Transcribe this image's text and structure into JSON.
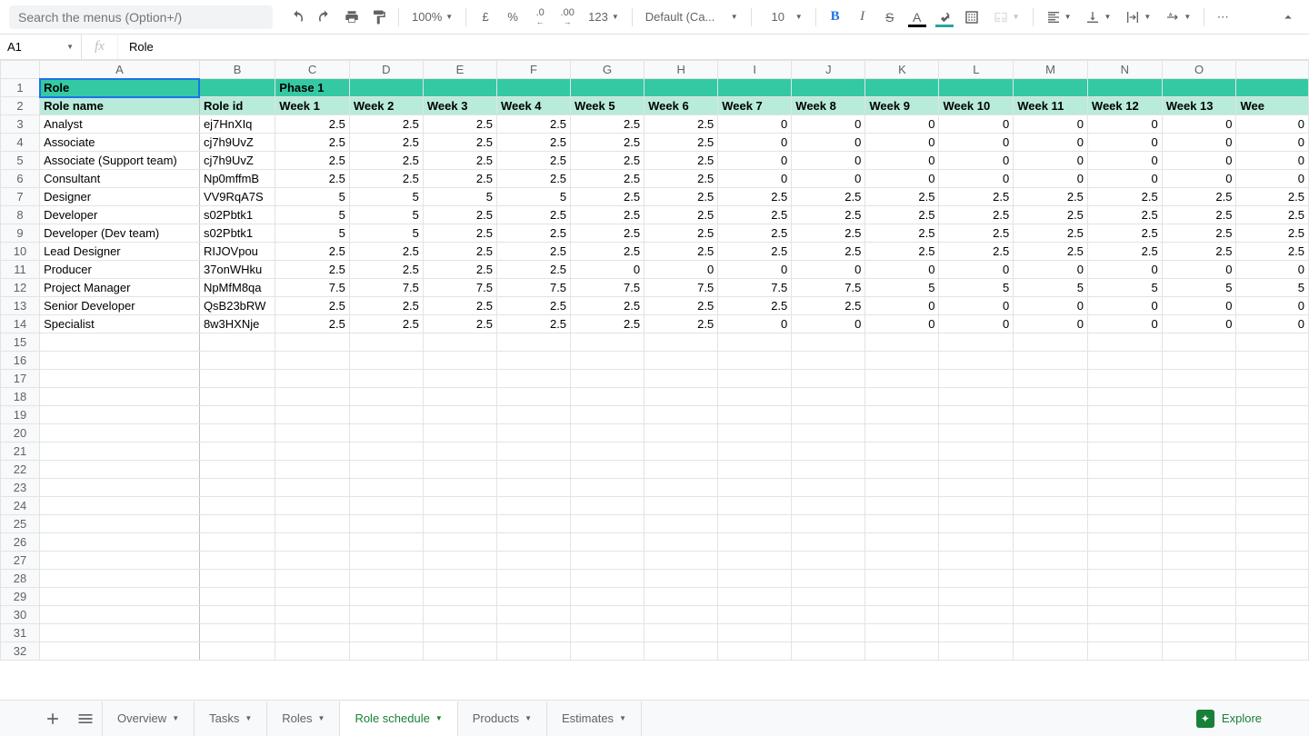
{
  "toolbar": {
    "search_placeholder": "Search the menus (Option+/)",
    "zoom": "100%",
    "currency": "£",
    "percent": "%",
    "dec_minus": ".0",
    "dec_plus": ".00",
    "more_fmt": "123",
    "font_name": "Default (Ca...",
    "font_size": "10",
    "bold": "B",
    "italic": "I",
    "strike": "S",
    "text_color": "A",
    "more": "⋯"
  },
  "name_box": "A1",
  "formula_value": "Role",
  "colors": {
    "header1": "#34c9a3",
    "header2": "#b8ebd9",
    "selection": "#1a73e8",
    "explore": "#188038"
  },
  "columns": [
    "A",
    "B",
    "C",
    "D",
    "E",
    "F",
    "G",
    "H",
    "I",
    "J",
    "K",
    "L",
    "M",
    "N",
    "O",
    ""
  ],
  "row1": {
    "A": "Role",
    "C": "Phase 1"
  },
  "row2": [
    "Role name",
    "Role id",
    "Week 1",
    "Week 2",
    "Week 3",
    "Week 4",
    "Week 5",
    "Week 6",
    "Week 7",
    "Week 8",
    "Week 9",
    "Week 10",
    "Week 11",
    "Week 12",
    "Week 13",
    "Wee"
  ],
  "rows": [
    {
      "name": "Analyst",
      "id": "ej7HnXIq",
      "v": [
        2.5,
        2.5,
        2.5,
        2.5,
        2.5,
        2.5,
        0,
        0,
        0,
        0,
        0,
        0,
        0,
        0
      ]
    },
    {
      "name": "Associate",
      "id": "cj7h9UvZ",
      "v": [
        2.5,
        2.5,
        2.5,
        2.5,
        2.5,
        2.5,
        0,
        0,
        0,
        0,
        0,
        0,
        0,
        0
      ]
    },
    {
      "name": "Associate (Support team)",
      "id": "cj7h9UvZ",
      "v": [
        2.5,
        2.5,
        2.5,
        2.5,
        2.5,
        2.5,
        0,
        0,
        0,
        0,
        0,
        0,
        0,
        0
      ]
    },
    {
      "name": "Consultant",
      "id": "Np0mffmB",
      "v": [
        2.5,
        2.5,
        2.5,
        2.5,
        2.5,
        2.5,
        0,
        0,
        0,
        0,
        0,
        0,
        0,
        0
      ]
    },
    {
      "name": "Designer",
      "id": "VV9RqA7S",
      "v": [
        5,
        5,
        5,
        5,
        2.5,
        2.5,
        2.5,
        2.5,
        2.5,
        2.5,
        2.5,
        2.5,
        2.5,
        2.5
      ]
    },
    {
      "name": "Developer",
      "id": "s02Pbtk1",
      "v": [
        5,
        5,
        2.5,
        2.5,
        2.5,
        2.5,
        2.5,
        2.5,
        2.5,
        2.5,
        2.5,
        2.5,
        2.5,
        2.5
      ]
    },
    {
      "name": "Developer (Dev team)",
      "id": "s02Pbtk1",
      "v": [
        5,
        5,
        2.5,
        2.5,
        2.5,
        2.5,
        2.5,
        2.5,
        2.5,
        2.5,
        2.5,
        2.5,
        2.5,
        2.5
      ]
    },
    {
      "name": "Lead Designer",
      "id": "RIJOVpou",
      "v": [
        2.5,
        2.5,
        2.5,
        2.5,
        2.5,
        2.5,
        2.5,
        2.5,
        2.5,
        2.5,
        2.5,
        2.5,
        2.5,
        2.5
      ]
    },
    {
      "name": "Producer",
      "id": "37onWHku",
      "v": [
        2.5,
        2.5,
        2.5,
        2.5,
        0,
        0,
        0,
        0,
        0,
        0,
        0,
        0,
        0,
        0
      ]
    },
    {
      "name": "Project Manager",
      "id": "NpMfM8qa",
      "v": [
        7.5,
        7.5,
        7.5,
        7.5,
        7.5,
        7.5,
        7.5,
        7.5,
        5,
        5,
        5,
        5,
        5,
        5
      ]
    },
    {
      "name": "Senior Developer",
      "id": "QsB23bRW",
      "v": [
        2.5,
        2.5,
        2.5,
        2.5,
        2.5,
        2.5,
        2.5,
        2.5,
        0,
        0,
        0,
        0,
        0,
        0
      ]
    },
    {
      "name": "Specialist",
      "id": "8w3HXNje",
      "v": [
        2.5,
        2.5,
        2.5,
        2.5,
        2.5,
        2.5,
        0,
        0,
        0,
        0,
        0,
        0,
        0,
        0
      ]
    }
  ],
  "empty_rows_from": 15,
  "empty_rows_to": 32,
  "tabs": [
    {
      "label": "Overview",
      "active": false
    },
    {
      "label": "Tasks",
      "active": false
    },
    {
      "label": "Roles",
      "active": false
    },
    {
      "label": "Role schedule",
      "active": true
    },
    {
      "label": "Products",
      "active": false
    },
    {
      "label": "Estimates",
      "active": false
    }
  ],
  "explore_label": "Explore"
}
